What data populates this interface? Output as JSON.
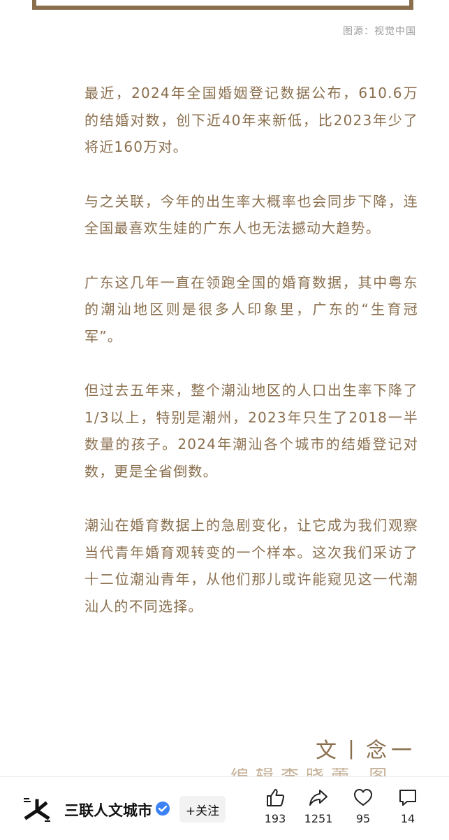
{
  "image_caption": "图源：视觉中国",
  "paragraphs": [
    "最近，2024年全国婚姻登记数据公布，610.6万的结婚对数，创下近40年来新低，比2023年少了将近160万对。",
    "与之关联，今年的出生率大概率也会同步下降，连全国最喜欢生娃的广东人也无法撼动大趋势。",
    "广东这几年一直在领跑全国的婚育数据，其中粤东的潮汕地区则是很多人印象里，广东的“生育冠军”。",
    "但过去五年来，整个潮汕地区的人口出生率下降了1/3以上，特别是潮州，2023年只生了2018一半数量的孩子。2024年潮汕各个城市的结婚登记对数，更是全省倒数。",
    "潮汕在婚育数据上的急剧变化，让它成为我们观察当代青年婚育观转变的一个样本。这次我们采访了十二位潮汕青年，从他们那儿或许能窥见这一代潮汕人的不同选择。"
  ],
  "byline": "文丨念一",
  "next_line_partial": "编辑李晓蕾 图",
  "footer": {
    "channel_name": "三联人文城市",
    "follow_label": "+关注",
    "stats": {
      "likes": "193",
      "shares": "1251",
      "favorites": "95",
      "comments": "14"
    }
  },
  "colors": {
    "text_brown": "#8a6f4e",
    "caption_gray": "#9b9b9b",
    "verified_blue": "#3b82f6"
  }
}
